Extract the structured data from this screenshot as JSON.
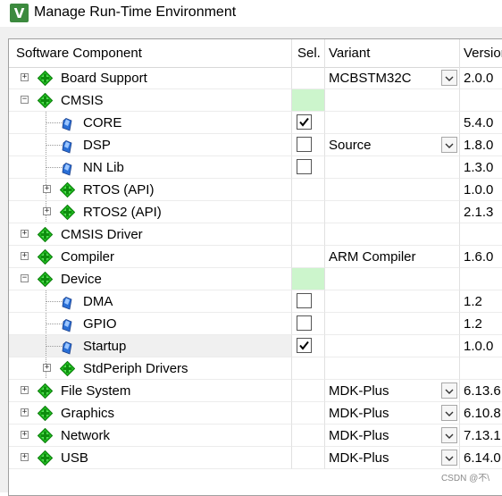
{
  "window": {
    "title": "Manage Run-Time Environment",
    "app_icon_letter": "V"
  },
  "columns": {
    "component": "Software Component",
    "sel": "Sel.",
    "variant": "Variant",
    "version": "Version"
  },
  "rows": [
    {
      "name": "Board Support",
      "level": 0,
      "expander": "+",
      "icon": "diamond",
      "variant": "MCBSTM32C",
      "dropdown": true,
      "version": "2.0.0",
      "check": null,
      "green": false
    },
    {
      "name": "CMSIS",
      "level": 0,
      "expander": "-",
      "icon": "diamond",
      "variant": "",
      "dropdown": false,
      "version": "",
      "check": null,
      "green": true
    },
    {
      "name": "CORE",
      "level": 1,
      "expander": "",
      "icon": "gem",
      "variant": "",
      "dropdown": false,
      "version": "5.4.0",
      "check": true,
      "green": false
    },
    {
      "name": "DSP",
      "level": 1,
      "expander": "",
      "icon": "gem",
      "variant": "Source",
      "dropdown": true,
      "version": "1.8.0",
      "check": false,
      "green": false
    },
    {
      "name": "NN Lib",
      "level": 1,
      "expander": "",
      "icon": "gem",
      "variant": "",
      "dropdown": false,
      "version": "1.3.0",
      "check": false,
      "green": false
    },
    {
      "name": "RTOS (API)",
      "level": 1,
      "expander": "+",
      "icon": "diamond",
      "variant": "",
      "dropdown": false,
      "version": "1.0.0",
      "check": null,
      "green": false
    },
    {
      "name": "RTOS2 (API)",
      "level": 1,
      "expander": "+",
      "icon": "diamond",
      "variant": "",
      "dropdown": false,
      "version": "2.1.3",
      "check": null,
      "green": false
    },
    {
      "name": "CMSIS Driver",
      "level": 0,
      "expander": "+",
      "icon": "diamond",
      "variant": "",
      "dropdown": false,
      "version": "",
      "check": null,
      "green": false
    },
    {
      "name": "Compiler",
      "level": 0,
      "expander": "+",
      "icon": "diamond",
      "variant": "ARM Compiler",
      "dropdown": false,
      "version": "1.6.0",
      "check": null,
      "green": false
    },
    {
      "name": "Device",
      "level": 0,
      "expander": "-",
      "icon": "diamond",
      "variant": "",
      "dropdown": false,
      "version": "",
      "check": null,
      "green": true
    },
    {
      "name": "DMA",
      "level": 1,
      "expander": "",
      "icon": "gem",
      "variant": "",
      "dropdown": false,
      "version": "1.2",
      "check": false,
      "green": false
    },
    {
      "name": "GPIO",
      "level": 1,
      "expander": "",
      "icon": "gem",
      "variant": "",
      "dropdown": false,
      "version": "1.2",
      "check": false,
      "green": false
    },
    {
      "name": "Startup",
      "level": 1,
      "expander": "",
      "icon": "gem",
      "variant": "",
      "dropdown": false,
      "version": "1.0.0",
      "check": true,
      "green": false,
      "selected": true
    },
    {
      "name": "StdPeriph Drivers",
      "level": 1,
      "expander": "+",
      "icon": "diamond",
      "variant": "",
      "dropdown": false,
      "version": "",
      "check": null,
      "green": false
    },
    {
      "name": "File System",
      "level": 0,
      "expander": "+",
      "icon": "diamond",
      "variant": "MDK-Plus",
      "dropdown": true,
      "version": "6.13.6",
      "check": null,
      "green": false
    },
    {
      "name": "Graphics",
      "level": 0,
      "expander": "+",
      "icon": "diamond",
      "variant": "MDK-Plus",
      "dropdown": true,
      "version": "6.10.8",
      "check": null,
      "green": false
    },
    {
      "name": "Network",
      "level": 0,
      "expander": "+",
      "icon": "diamond",
      "variant": "MDK-Plus",
      "dropdown": true,
      "version": "7.13.1",
      "check": null,
      "green": false
    },
    {
      "name": "USB",
      "level": 0,
      "expander": "+",
      "icon": "diamond",
      "variant": "MDK-Plus",
      "dropdown": true,
      "version": "6.14.0",
      "check": null,
      "green": false
    }
  ],
  "watermark": "CSDN @不\\",
  "colors": {
    "selection_green": "#ccf5cc",
    "diamond_green": "#22c022",
    "gem_blue": "#2a6fd6"
  }
}
